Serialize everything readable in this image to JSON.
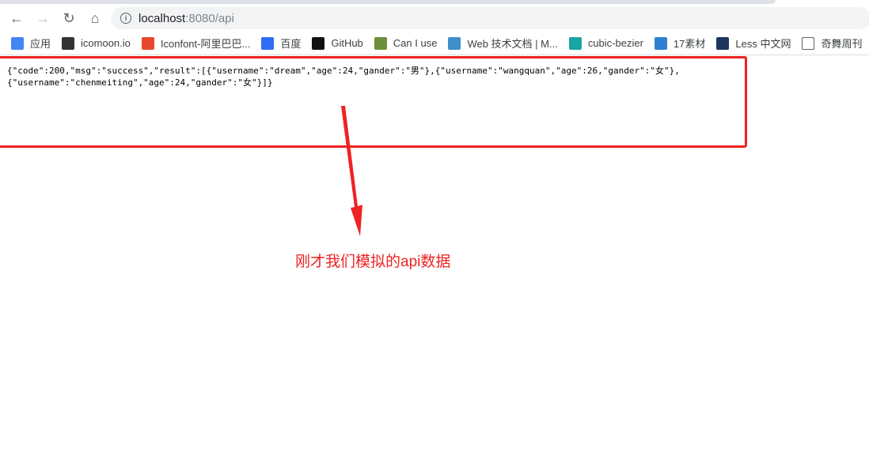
{
  "browser": {
    "url_host": "localhost",
    "url_path": ":8080/api",
    "bookmarks": [
      {
        "label": "应用",
        "icon": "apps-grid-icon",
        "color": "#4285f4"
      },
      {
        "label": "icomoon.io",
        "icon": "icomoon-icon",
        "color": "#333333"
      },
      {
        "label": "Iconfont-阿里巴巴...",
        "icon": "iconfont-icon",
        "color": "#e8492d"
      },
      {
        "label": "百度",
        "icon": "baidu-paw-icon",
        "color": "#2f6df5"
      },
      {
        "label": "GitHub",
        "icon": "github-icon",
        "color": "#111111"
      },
      {
        "label": "Can I use",
        "icon": "caniuse-icon",
        "color": "#6b8f3a"
      },
      {
        "label": "Web 技术文档 | M...",
        "icon": "mdn-icon",
        "color": "#3f8fc9"
      },
      {
        "label": "cubic-bezier",
        "icon": "cubic-bezier-icon",
        "color": "#1aa5a5"
      },
      {
        "label": "17素材",
        "icon": "17sucai-icon",
        "color": "#2f7fd0"
      },
      {
        "label": "Less 中文网",
        "icon": "less-icon",
        "color": "#1d365d"
      },
      {
        "label": "奇舞周刊",
        "icon": "page-icon",
        "color": "#ffffff"
      }
    ]
  },
  "page": {
    "json_lines": [
      "{\"code\":200,\"msg\":\"success\",\"result\":[{\"username\":\"dream\",\"age\":24,\"gander\":\"男\"},{\"username\":\"wangquan\",\"age\":26,\"gander\":\"女\"},",
      "{\"username\":\"chenmeiting\",\"age\":24,\"gander\":\"女\"}]}"
    ],
    "annotation": "刚才我们模拟的api数据",
    "annotation_color": "#f02222"
  }
}
